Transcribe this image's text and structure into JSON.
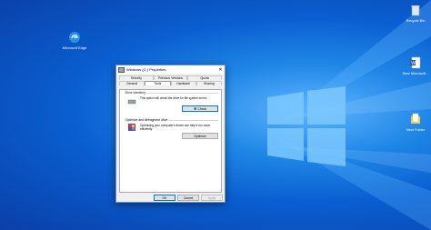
{
  "desktop": {
    "icons": [
      {
        "name": "recycle-bin-icon",
        "label": "Recycle Bin"
      },
      {
        "name": "edge-icon",
        "label": "Microsoft Edge"
      },
      {
        "name": "word-document-icon",
        "label": "New Microsoft..."
      },
      {
        "name": "folder-icon",
        "label": "New Folder"
      }
    ]
  },
  "dialog": {
    "title": "Windows (C:) Properties",
    "close_label": "✕",
    "tabs_top": [
      "Security",
      "Previous Versions",
      "Quota"
    ],
    "tabs_bottom": [
      "General",
      "Tools",
      "Hardware",
      "Sharing"
    ],
    "active_tab": "Tools",
    "error_checking": {
      "heading": "Error checking",
      "description": "This option will check the drive for file system errors.",
      "button": "Check"
    },
    "optimize": {
      "heading": "Optimize and defragment drive",
      "description": "Optimizing your computer's drives can help it run more efficiently.",
      "button": "Optimize"
    },
    "footer": {
      "ok": "OK",
      "cancel": "Cancel",
      "apply": "Apply"
    }
  },
  "colors": {
    "accent": "#0078d7",
    "desktop_blue": "#0a5ed0"
  }
}
